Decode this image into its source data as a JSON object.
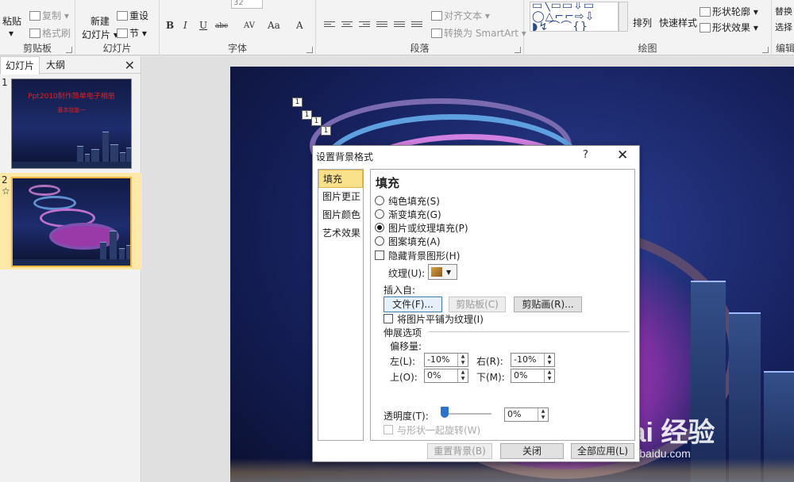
{
  "ribbon": {
    "clipboard": {
      "paste": "粘贴",
      "paste_arrow": "▾",
      "copy": "复制",
      "copy_arrow": "▾",
      "format_painter": "格式刷",
      "group": "剪贴板"
    },
    "slides": {
      "new_slide": "新建",
      "new_slide2": "幻灯片 ▾",
      "reset": "重设",
      "section": "节 ▾",
      "group": "幻灯片"
    },
    "font": {
      "size": "32",
      "bold": "B",
      "italic": "I",
      "underline": "U",
      "strike": "abc",
      "spacing": "AV",
      "case": "Aa",
      "color": "A",
      "group": "字体"
    },
    "paragraph": {
      "align_text": "对齐文本 ▾",
      "smartart": "转换为 SmartArt ▾",
      "group": "段落"
    },
    "drawing": {
      "shapes_row1": "▭╲▭▭⇩▭",
      "shapes_row2": "◯△⌐⌐⇨⇩",
      "shapes_row3": "◗↯⌒⌒{}",
      "arrange": "排列",
      "quick_styles": "快速样式",
      "shape_outline": "形状轮廓 ▾",
      "shape_effects": "形状效果 ▾",
      "group": "绘图"
    },
    "editing": {
      "replace": "替换",
      "select": "选择",
      "group": "编辑"
    }
  },
  "pane": {
    "tab_slides": "幻灯片",
    "tab_outline": "大纲",
    "close": "✕",
    "slide1_num": "1",
    "slide1_title": "Ppt2010制作简单电子相册",
    "slide1_sub": "基本技能一",
    "slide2_num": "2",
    "slide2_star": "☆"
  },
  "slide": {
    "marker": "1"
  },
  "watermark": {
    "brand": "Bai 经验",
    "url": "jingyan.baidu.com"
  },
  "dialog": {
    "title": "设置背景格式",
    "help": "?",
    "close": "✕",
    "nav": [
      "填充",
      "图片更正",
      "图片颜色",
      "艺术效果"
    ],
    "heading": "填充",
    "solid_fill": "纯色填充(S)",
    "gradient_fill": "渐变填充(G)",
    "picture_fill": "图片或纹理填充(P)",
    "pattern_fill": "图案填充(A)",
    "hide_bg": "隐藏背景图形(H)",
    "texture": "纹理(U):",
    "insert_from": "插入自:",
    "file_btn": "文件(F)...",
    "clipboard_btn": "剪贴板(C)",
    "clipart_btn": "剪贴画(R)...",
    "tile": "将图片平铺为纹理(I)",
    "stretch": "伸展选项",
    "offset": "偏移量:",
    "left": "左(L):",
    "left_val": "-10%",
    "right": "右(R):",
    "right_val": "-10%",
    "top": "上(O):",
    "top_val": "0%",
    "bottom": "下(M):",
    "bottom_val": "0%",
    "transparency": "透明度(T):",
    "transparency_val": "0%",
    "rotate": "与形状一起旋转(W)",
    "reset_btn": "重置背景(B)",
    "close_btn": "关闭",
    "apply_all_btn": "全部应用(L)"
  }
}
